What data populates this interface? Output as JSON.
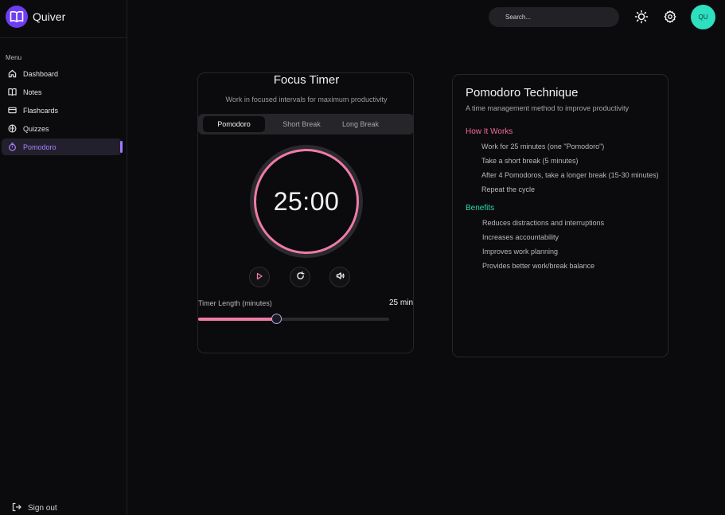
{
  "app": {
    "name": "Quiver"
  },
  "sidebar": {
    "menu_label": "Menu",
    "items": [
      {
        "label": "Dashboard",
        "icon": "home-icon"
      },
      {
        "label": "Notes",
        "icon": "book-icon"
      },
      {
        "label": "Flashcards",
        "icon": "card-icon"
      },
      {
        "label": "Quizzes",
        "icon": "brain-icon"
      },
      {
        "label": "Pomodoro",
        "icon": "timer-icon",
        "active": true
      }
    ],
    "signout_label": "Sign out"
  },
  "header": {
    "search_placeholder": "Search...",
    "avatar_initials": "QU"
  },
  "timer": {
    "title": "Focus Timer",
    "subtitle": "Work in focused intervals for maximum productivity",
    "tabs": [
      "Pomodoro",
      "Short Break",
      "Long Break"
    ],
    "active_tab": "Pomodoro",
    "time": "25:00",
    "length_label": "Timer Length (minutes)",
    "length_value": "25 min",
    "slider_fraction": 0.41
  },
  "info": {
    "title": "Pomodoro Technique",
    "subtitle": "A time management method to improve productivity",
    "how_heading": "How It Works",
    "how_items": [
      "Work for 25 minutes (one \"Pomodoro\")",
      "Take a short break (5 minutes)",
      "After 4 Pomodoros, take a longer break (15-30 minutes)",
      "Repeat the cycle"
    ],
    "benefits_heading": "Benefits",
    "benefits_items": [
      "Reduces distractions and interruptions",
      "Increases accountability",
      "Improves work planning",
      "Provides better work/break balance"
    ]
  },
  "colors": {
    "accent_purple": "#6d3df2",
    "active_nav": "#a985ff",
    "pink": "#f07ba6",
    "teal": "#2ee0bf"
  }
}
